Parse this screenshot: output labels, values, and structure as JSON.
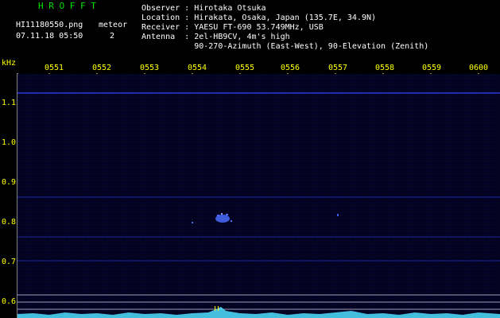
{
  "header": {
    "station": "H R O F F T",
    "filename": "HI11180550.png",
    "meteor_label": "meteor",
    "timestamp": "07.11.18 05:50",
    "meteor_count": "2",
    "observer": "Observer : Hirotaka Otsuka",
    "location": "Location : Hirakata, Osaka, Japan (135.7E, 34.9N)",
    "receiver": "Receiver : YAESU FT-690 53.749MHz, USB",
    "antenna": "Antenna  : 2el-HB9CV, 4m's high",
    "antenna2": "           90-270-Azimuth (East-West), 90-Elevation (Zenith)"
  },
  "axis": {
    "unit": "kHz",
    "time_ticks": [
      "0551",
      "0552",
      "0553",
      "0554",
      "0555",
      "0556",
      "0557",
      "0558",
      "0559",
      "0600"
    ],
    "freq_ticks": [
      "1.1",
      "1.0",
      "0.9",
      "0.8",
      "0.7",
      "0.6"
    ]
  },
  "colors": {
    "label_green": "#00e000",
    "tick_yellow": "#ffff00",
    "background": "#000000",
    "spectrogram": "#03031f",
    "signal": "#4a6cff",
    "meter": "#4fe0ff"
  }
}
